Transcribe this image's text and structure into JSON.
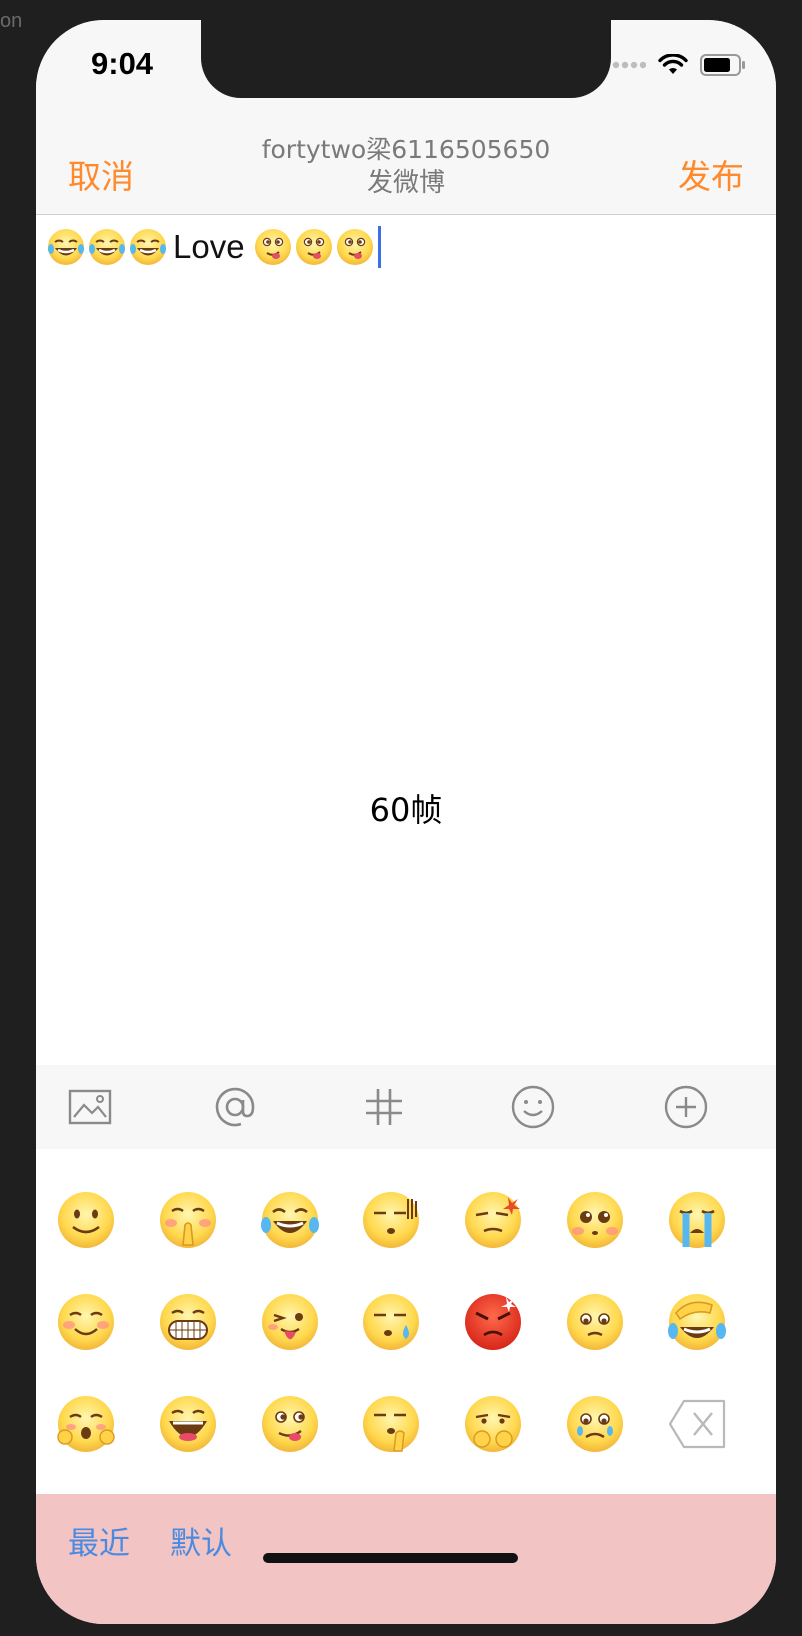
{
  "edge_fragment": "on",
  "status_bar": {
    "time": "9:04",
    "icons": [
      "signal-dots-icon",
      "wifi-icon",
      "battery-icon"
    ]
  },
  "nav": {
    "cancel_label": "取消",
    "subtitle": "fortytwo梁6116505650",
    "title": "发微博",
    "publish_label": "发布",
    "accent_color": "#ff8a2c"
  },
  "compose": {
    "leading_emojis": [
      "laugh-cry-emoji",
      "laugh-cry-emoji",
      "laugh-cry-emoji"
    ],
    "text": "Love",
    "trailing_emojis": [
      "tongue-wink-emoji",
      "tongue-wink-emoji",
      "tongue-wink-emoji"
    ],
    "fps_label": "60帧"
  },
  "toolbar": {
    "items": [
      "picture-icon",
      "mention-icon",
      "hashtag-icon",
      "emoticon-icon",
      "add-icon"
    ]
  },
  "emoji_grid": [
    [
      "smile",
      "blush-pray",
      "laugh-cry",
      "speechless",
      "angry-vein",
      "teary",
      "cry"
    ],
    [
      "shy-smile",
      "grin-teeth",
      "tongue-wink",
      "sweat",
      "rage",
      "worried",
      "facepalm-laugh"
    ],
    [
      "cheeky",
      "open-laugh",
      "yum",
      "shh",
      "covered-mouth",
      "sad-teary",
      "backspace"
    ]
  ],
  "bottom_tabs": [
    {
      "label": "最近"
    },
    {
      "label": "默认"
    }
  ],
  "colors": {
    "tab_text": "#4a8ae0",
    "bottom_bar": "#f2c4c4",
    "caret": "#3b6ee8"
  }
}
